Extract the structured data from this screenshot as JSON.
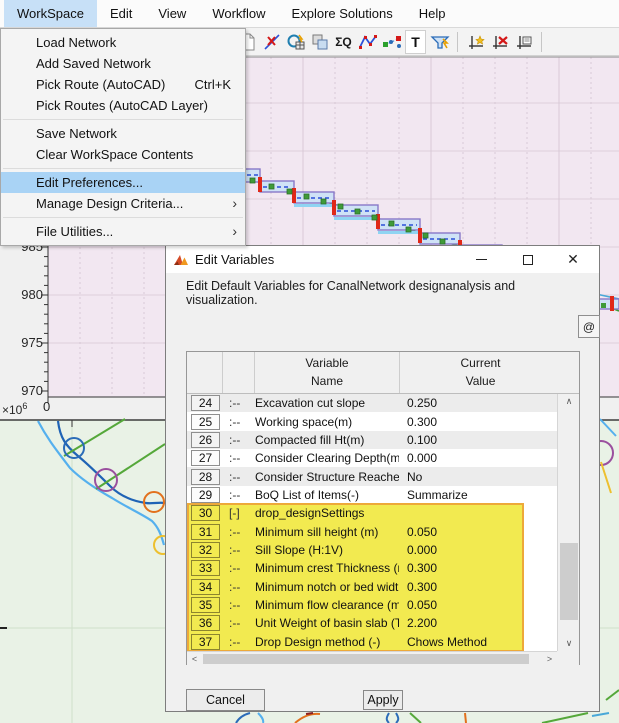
{
  "colors": {
    "menu_highlight": "#a9d3f5",
    "menubar_active": "#c7e0f7",
    "row_highlight": "#f2ea50",
    "row_highlight_border": "#eda93a",
    "plot_background": "#f2e7f1",
    "map_background": "#e9f2e6"
  },
  "menu_bar": {
    "items": [
      {
        "label": "WorkSpace",
        "active": true
      },
      {
        "label": "Edit"
      },
      {
        "label": "View"
      },
      {
        "label": "Workflow"
      },
      {
        "label": "Explore Solutions"
      },
      {
        "label": "Help"
      }
    ]
  },
  "workspace_menu": {
    "items": [
      {
        "label": "Load Network"
      },
      {
        "label": "Add Saved Network"
      },
      {
        "label": "Pick Route (AutoCAD)",
        "shortcut": "Ctrl+K"
      },
      {
        "label": "Pick Routes (AutoCAD Layer)",
        "separator_after": true
      },
      {
        "label": "Save Network"
      },
      {
        "label": "Clear WorkSpace Contents",
        "separator_after": true
      },
      {
        "label": "Edit Preferences...",
        "highlighted": true
      },
      {
        "label": "Manage Design Criteria...",
        "submenu": true,
        "separator_after": true
      },
      {
        "label": "File Utilities...",
        "submenu": true
      }
    ],
    "submenu_arrow": "›"
  },
  "toolbar": {
    "icons": [
      "document",
      "pick-route",
      "design-table",
      "layers",
      "sum-q",
      "profile-polyline",
      "node-network",
      "text-annotation",
      "flume-structure",
      "add-axes",
      "delete-axes",
      "axes-report"
    ],
    "sum_q_label": "ΣQ",
    "text_tool_label": "T"
  },
  "plot": {
    "y_ticks": [
      "985",
      "980",
      "975",
      "970"
    ],
    "x_tick": "0",
    "exponent_base": "×10",
    "exponent_power": "6"
  },
  "dialog": {
    "title": "Edit Variables",
    "message": "Edit Default Variables for CanalNetwork designanalysis and visualization.",
    "at_button": "@",
    "close_glyph": "✕",
    "table": {
      "headers": {
        "variable_line1": "Variable",
        "variable_line2": "Name",
        "current_line1": "Current",
        "current_line2": "Value"
      },
      "scroll": {
        "up": "∧",
        "down": "∨",
        "left": "<",
        "right": ">"
      },
      "rows": [
        {
          "num": "24",
          "sym": ":--",
          "name": "Excavation cut slope",
          "value": "0.250",
          "shade": true
        },
        {
          "num": "25",
          "sym": ":--",
          "name": "Working space(m)",
          "value": "0.300"
        },
        {
          "num": "26",
          "sym": ":--",
          "name": "Compacted fill Ht(m)",
          "value": "0.100",
          "shade": true
        },
        {
          "num": "27",
          "sym": ":--",
          "name": "Consider Clearing Depth(m):",
          "value": "0.000"
        },
        {
          "num": "28",
          "sym": ":--",
          "name": "Consider Structure Reaches...",
          "value": "No",
          "shade": true
        },
        {
          "num": "29",
          "sym": ":--",
          "name": "BoQ List of Items(-)",
          "value": "Summarize"
        },
        {
          "num": "30",
          "sym": "[-]",
          "name": "drop_designSettings",
          "value": "",
          "highlight": true
        },
        {
          "num": "31",
          "sym": ":--",
          "name": "Minimum sill height (m)",
          "value": "0.050",
          "highlight": true
        },
        {
          "num": "32",
          "sym": ":--",
          "name": "Sill Slope (H:1V)",
          "value": "0.000",
          "highlight": true
        },
        {
          "num": "33",
          "sym": ":--",
          "name": "Minimum crest Thickness (m)",
          "value": "0.300",
          "highlight": true
        },
        {
          "num": "34",
          "sym": ":--",
          "name": "Minimum notch or bed width ...",
          "value": "0.300",
          "highlight": true
        },
        {
          "num": "35",
          "sym": ":--",
          "name": "Minimum flow clearance (m)",
          "value": "0.050",
          "highlight": true
        },
        {
          "num": "36",
          "sym": ":--",
          "name": "Unit Weight of basin slab (To...",
          "value": "2.200",
          "highlight": true
        },
        {
          "num": "37",
          "sym": ":--",
          "name": "Drop Design method (-)",
          "value": "Chows Method",
          "highlight": true
        }
      ]
    },
    "buttons": {
      "cancel": "Cancel",
      "apply": "Apply"
    }
  }
}
